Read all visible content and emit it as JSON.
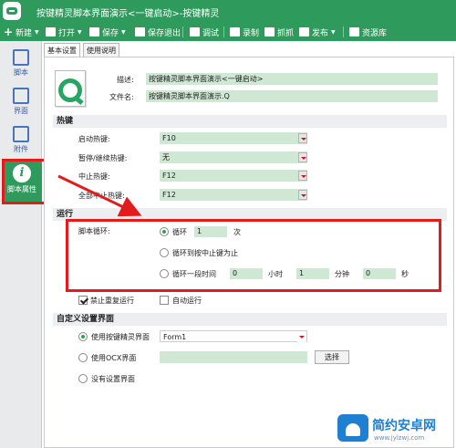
{
  "window": {
    "title": "按键精灵脚本界面演示<一键启动>-按键精灵"
  },
  "toolbar": {
    "items": [
      {
        "label": "新建",
        "icon": "plus-icon"
      },
      {
        "label": "打开",
        "icon": "folder-icon"
      },
      {
        "label": "保存",
        "icon": "save-icon"
      },
      {
        "label": "保存退出",
        "icon": "save-exit-icon"
      },
      {
        "label": "调试",
        "icon": "debug-play-icon"
      },
      {
        "label": "录制",
        "icon": "camera-icon"
      },
      {
        "label": "抓抓",
        "icon": "grab-icon"
      },
      {
        "label": "发布",
        "icon": "publish-icon"
      },
      {
        "label": "资源库",
        "icon": "resource-icon"
      }
    ]
  },
  "sidebar": {
    "items": [
      {
        "label": "脚本",
        "icon": "script-icon"
      },
      {
        "label": "界面",
        "icon": "interface-icon"
      },
      {
        "label": "附件",
        "icon": "attachment-icon"
      },
      {
        "label": "脚本属性",
        "icon": "info-icon"
      }
    ]
  },
  "tabs": [
    "基本设置",
    "使用说明"
  ],
  "basic": {
    "description_label": "描述:",
    "description_value": "按键精灵脚本界面演示<一键启动>",
    "filename_label": "文件名:",
    "filename_value": "按键精灵脚本界面演示.Q"
  },
  "hotkeys": {
    "section_title": "热键",
    "rows": [
      {
        "label": "启动热键:",
        "value": "F10"
      },
      {
        "label": "暂停/继续热键:",
        "value": "无"
      },
      {
        "label": "中止热键:",
        "value": "F12"
      },
      {
        "label": "全部中止热键:",
        "value": "F12"
      }
    ]
  },
  "run": {
    "section_title": "运行",
    "loop_label": "脚本循环:",
    "options": [
      {
        "label": "循环",
        "count": "1",
        "unit": "次",
        "selected": true
      },
      {
        "label": "循环到按中止键为止",
        "selected": false
      },
      {
        "label": "循环一段时间",
        "hours": "0",
        "hours_unit": "小时",
        "minutes": "1",
        "minutes_unit": "分钟",
        "seconds": "0",
        "seconds_unit": "秒",
        "selected": false
      }
    ],
    "no_repeat_label": "禁止重复运行",
    "no_repeat_checked": true,
    "auto_run_label": "自动运行",
    "auto_run_checked": false
  },
  "custom_ui": {
    "section_title": "自定义设置界面",
    "options": [
      {
        "label": "使用按键精灵界面",
        "value": "Form1",
        "selected": true
      },
      {
        "label": "使用OCX界面",
        "value": "",
        "button": "选择",
        "selected": false
      },
      {
        "label": "没有设置界面",
        "selected": false
      }
    ]
  },
  "watermark": {
    "title": "简约安卓网",
    "url": "www.jylzwj.com"
  },
  "colors": {
    "brand_green": "#2e9a5c",
    "field_green": "#cfe8d4",
    "highlight_red": "#e21c1c"
  }
}
